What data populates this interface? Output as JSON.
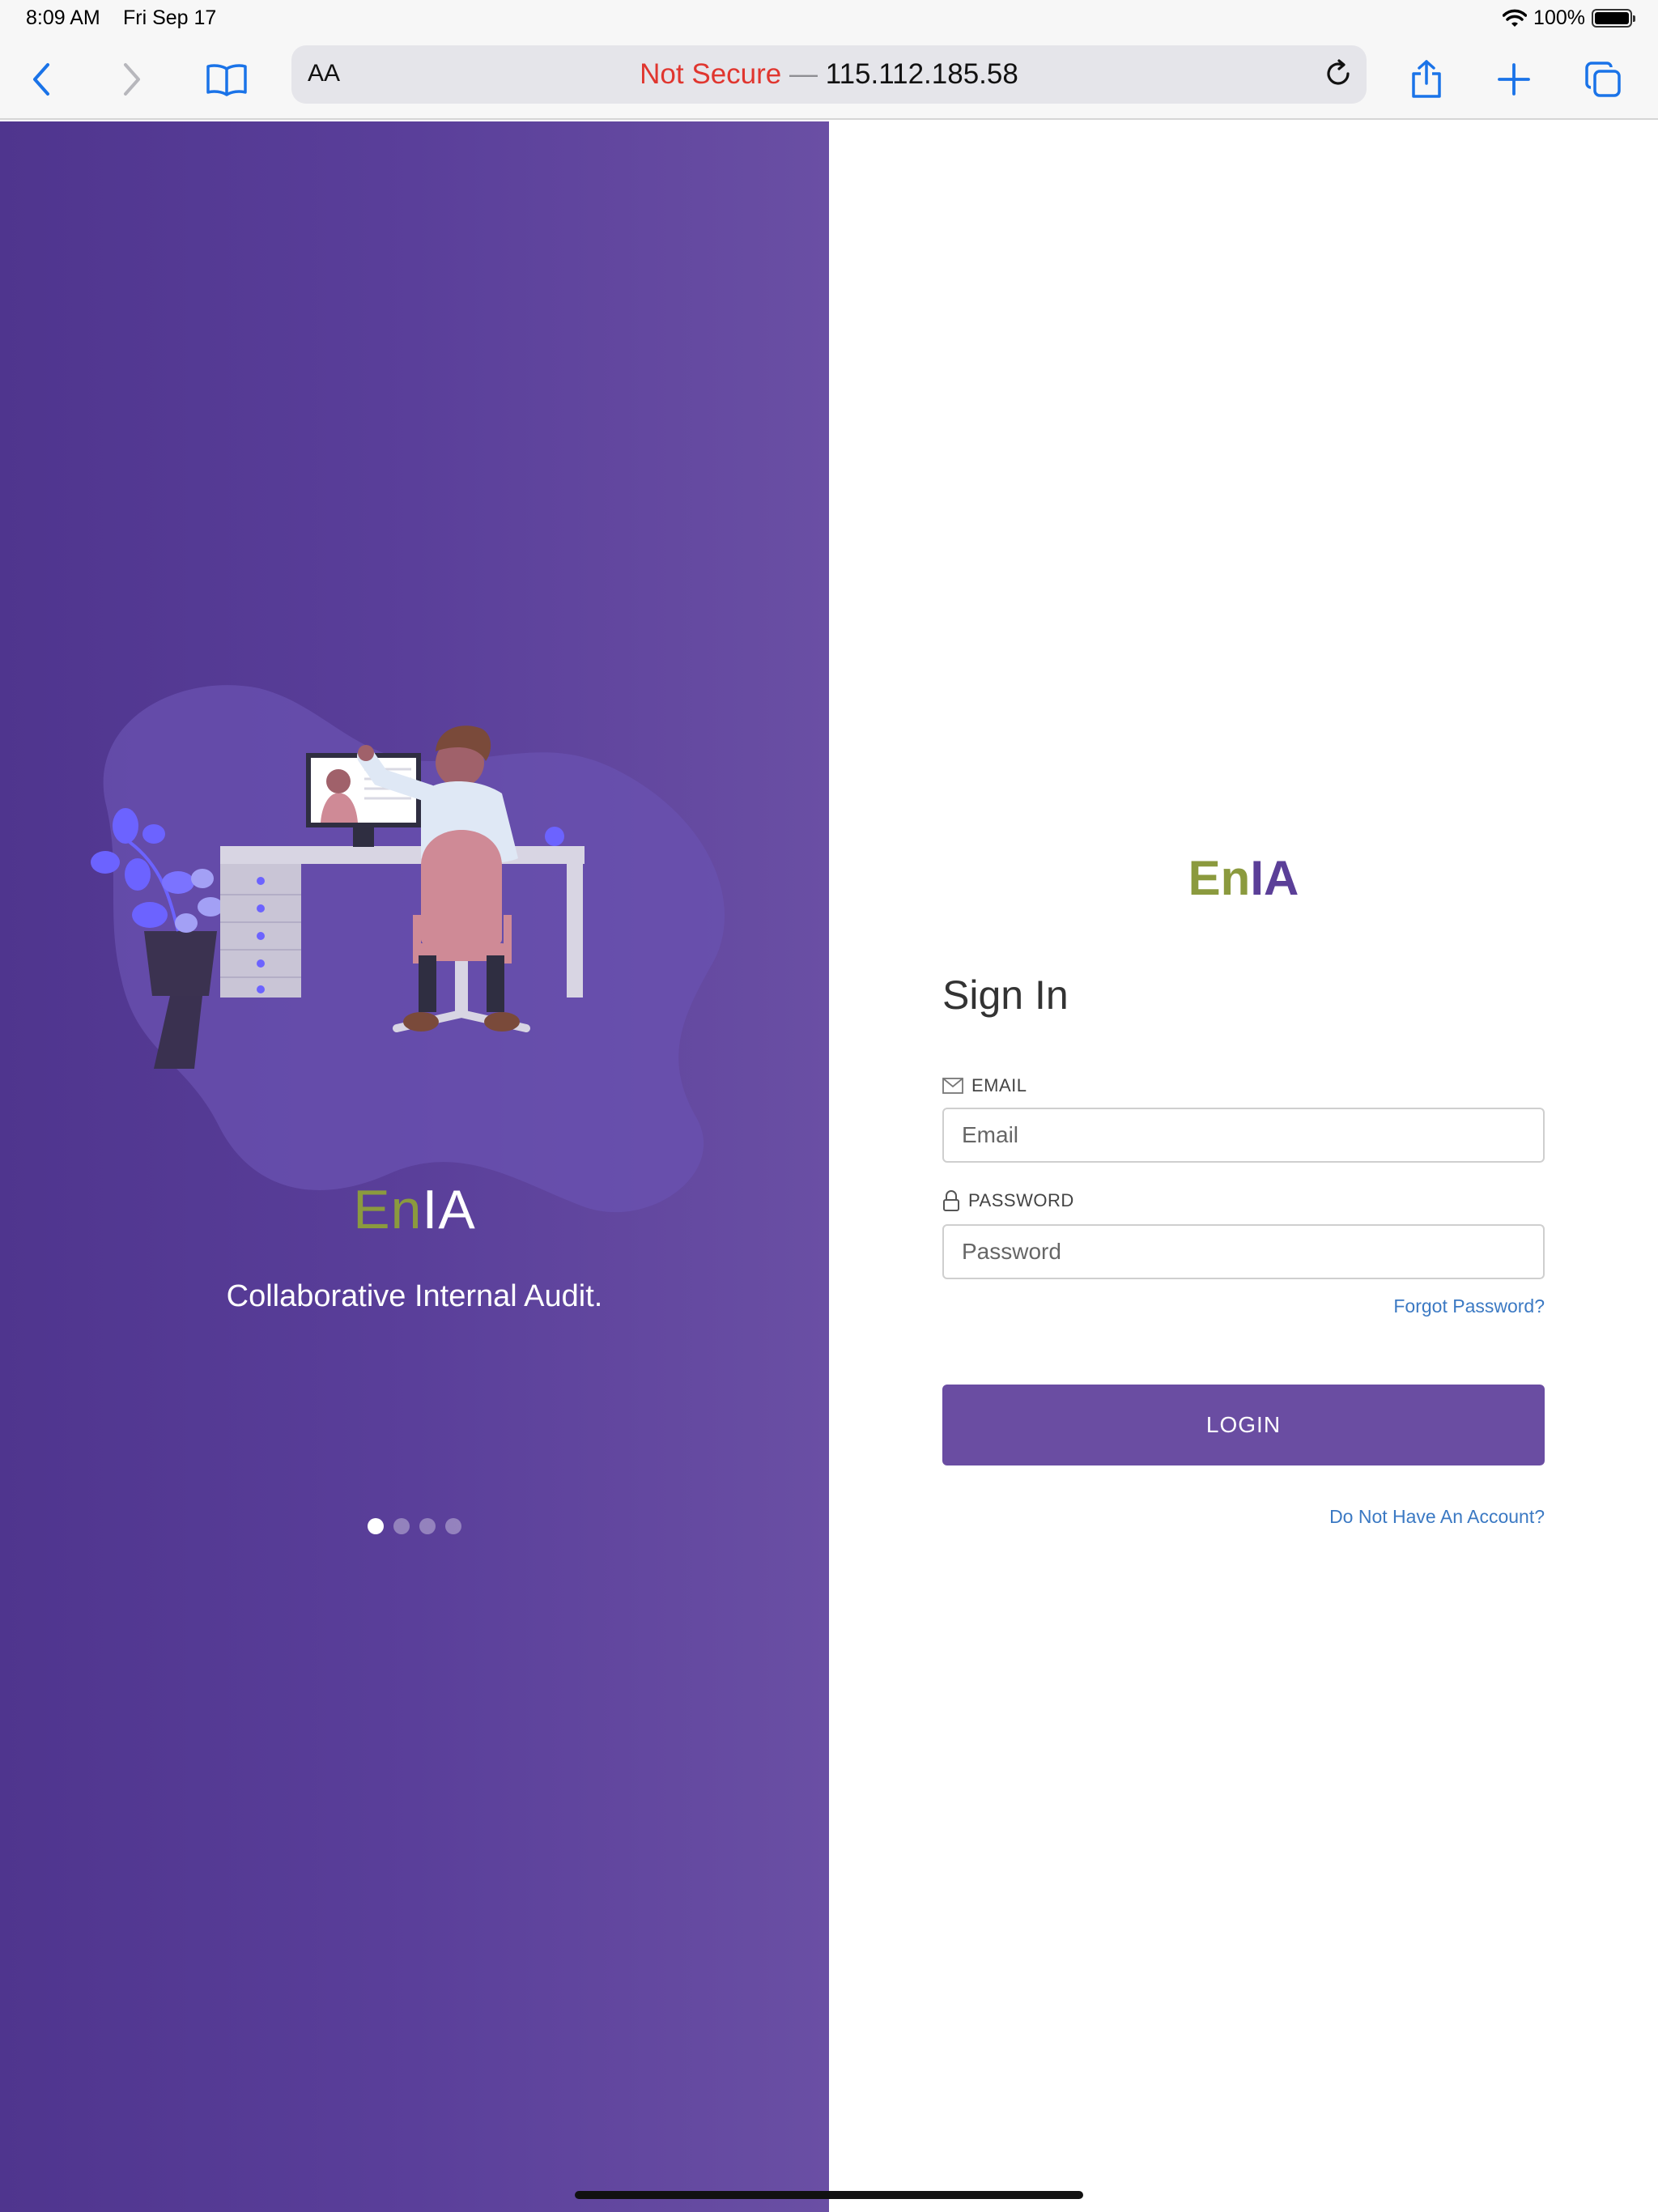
{
  "status_bar": {
    "time": "8:09 AM",
    "date": "Fri Sep 17",
    "battery": "100%"
  },
  "browser": {
    "aa_label": "AA",
    "security_warning": "Not Secure",
    "separator": "—",
    "address": "115.112.185.58"
  },
  "hero": {
    "brand_en": "En",
    "brand_ia": "IA",
    "tagline": "Collaborative Internal Audit.",
    "carousel_active_index": 0,
    "carousel_count": 4
  },
  "signin": {
    "brand_en": "En",
    "brand_ia": "IA",
    "title": "Sign In",
    "email_label": "EMAIL",
    "email_placeholder": "Email",
    "password_label": "PASSWORD",
    "password_placeholder": "Password",
    "forgot_password": "Forgot Password?",
    "login_button": "LOGIN",
    "no_account": "Do Not Have An Account?"
  },
  "colors": {
    "brand_green": "#8b9a3e",
    "brand_purple": "#5b3f98",
    "button_purple": "#6a4da2",
    "link_blue": "#3b79c3",
    "warning_red": "#e0362f"
  }
}
